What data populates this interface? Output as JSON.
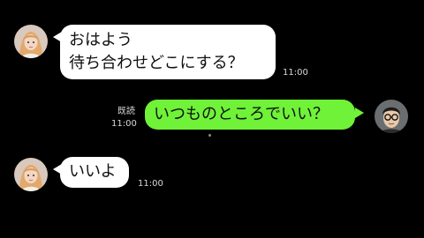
{
  "messages": [
    {
      "direction": "incoming",
      "lines": [
        "おはよう",
        "待ち合わせどこにする？"
      ],
      "time": "11:00"
    },
    {
      "direction": "outgoing",
      "lines": [
        "いつものところでいい？"
      ],
      "read_label": "既読",
      "time": "11:00"
    },
    {
      "direction": "incoming",
      "lines": [
        "いいよ"
      ],
      "time": "11:00"
    }
  ],
  "colors": {
    "background": "#000000",
    "incoming_bubble": "#ffffff",
    "outgoing_bubble": "#6ff238",
    "meta_text": "#d8d8d8"
  },
  "icons": {
    "contact_avatar": "woman-avatar-icon",
    "self_avatar": "man-with-glasses-avatar-icon"
  }
}
